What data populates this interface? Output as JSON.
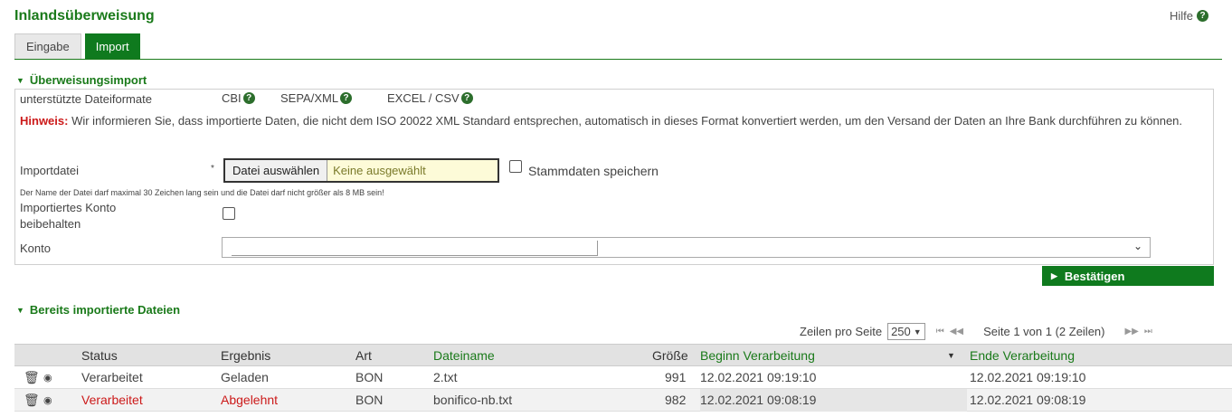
{
  "header": {
    "title": "Inlandsüberweisung",
    "help_label": "Hilfe",
    "help_icon": "question-icon"
  },
  "tabs": [
    {
      "label": "Eingabe",
      "active": false
    },
    {
      "label": "Import",
      "active": true
    }
  ],
  "import_section": {
    "title": "Überweisungsimport",
    "formats_label": "unterstützte Dateiformate",
    "formats": [
      "CBI",
      "SEPA/XML",
      "EXCEL / CSV"
    ],
    "hint_prefix": "Hinweis:",
    "hint_text": " Wir informieren Sie, dass importierte Daten, die nicht dem ISO 20022 XML Standard entsprechen, automatisch in dieses Format konvertiert werden, um den Versand der Daten an Ihre Bank durchführen zu können.",
    "importfile_label": "Importdatei",
    "required_mark": "*",
    "file_button": "Datei auswählen",
    "file_none": "Keine ausgewählt",
    "save_master_label": "Stammdaten speichern",
    "file_note": "Der Name der Datei darf maximal 30 Zeichen lang sein und die Datei darf nicht größer als 8 MB sein!",
    "keep_account_label_1": "Importiertes Konto",
    "keep_account_label_2": "beibehalten",
    "account_label": "Konto",
    "account_value": "",
    "confirm_label": "Bestätigen"
  },
  "imported_section": {
    "title": "Bereits importierte Dateien",
    "rows_per_page_label": "Zeilen pro Seite",
    "rows_per_page": "250",
    "page_info": "Seite 1 von 1 (2 Zeilen)",
    "columns": [
      "Status",
      "Ergebnis",
      "Art",
      "Dateiname",
      "Größe",
      "Beginn Verarbeitung",
      "Ende Verarbeitung"
    ],
    "rows": [
      {
        "status": "Verarbeitet",
        "result": "Geladen",
        "type": "BON",
        "filename": "2.txt",
        "size": "991",
        "start": "12.02.2021 09:19:10",
        "end": "12.02.2021 09:19:10",
        "error": false
      },
      {
        "status": "Verarbeitet",
        "result": "Abgelehnt",
        "type": "BON",
        "filename": "bonifico-nb.txt",
        "size": "982",
        "start": "12.02.2021 09:08:19",
        "end": "12.02.2021 09:08:19",
        "error": true
      }
    ]
  }
}
